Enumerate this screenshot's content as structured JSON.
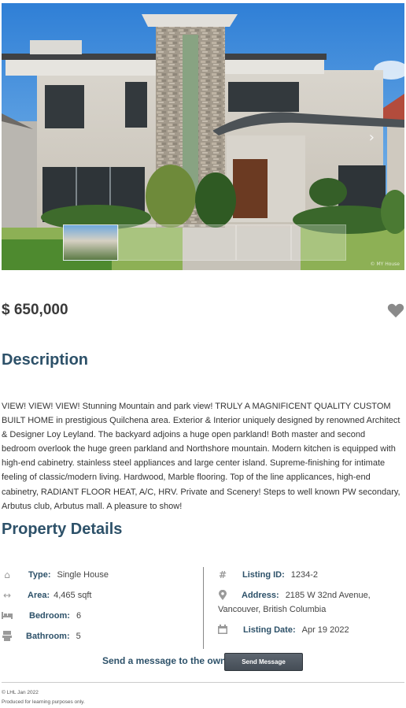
{
  "gallery": {
    "watermark": "© MY House",
    "thumbnail_count": 5
  },
  "listing": {
    "price": "$ 650,000",
    "favorite_icon": "heart-icon"
  },
  "description": {
    "heading": "Description",
    "text": "VIEW! VIEW! VIEW! Stunning Mountain and park view! TRULY A MAGNIFICENT QUALITY CUSTOM BUILT HOME in prestigious Quilchena area. Exterior & Interior uniquely designed by renowned Architect & Designer Loy Leyland. The backyard adjoins a huge open parkland! Both master and second bedroom overlook the huge green parkland and Northshore mountain. Modern kitchen is equipped with high-end cabinetry. stainless steel appliances and large center island. Supreme-finishing for intimate feeling of classic/modern living. Hardwood, Marble flooring. Top of the line applicances, high-end cabinetry, RADIANT FLOOR HEAT, A/C, HRV. Private and Scenery! Steps to well known PW secondary, Arbutus club, Arbutus mall. A pleasure to show!"
  },
  "details": {
    "heading": "Property Details",
    "type_label": "Type:",
    "type_value": "Single House",
    "area_label": "Area:",
    "area_value": "4,465 sqft",
    "bedroom_label": "Bedroom:",
    "bedroom_value": "6",
    "bathroom_label": "Bathroom:",
    "bathroom_value": "5",
    "listing_id_label": "Listing ID:",
    "listing_id_value": "1234-2",
    "address_label": "Address:",
    "address_line1": "2185 W 32nd Avenue,",
    "address_line2": "Vancouver, British Columbia",
    "listing_date_label": "Listing Date:",
    "listing_date_value": "Apr 19 2022"
  },
  "contact": {
    "label": "Send a message to the owner",
    "button": "Send Message"
  },
  "footer": {
    "copyright": "© LHL Jan 2022",
    "note": "Produced for learning purposes only."
  },
  "colors": {
    "heading": "#2d5169",
    "icon_gray": "#9a9a9a",
    "button_bg": "#4f5861"
  }
}
